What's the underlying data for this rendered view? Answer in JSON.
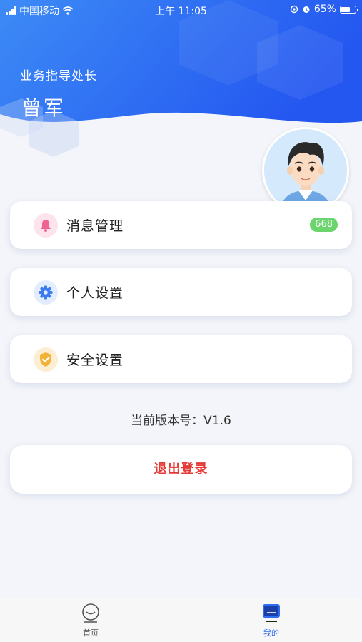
{
  "status_bar": {
    "carrier": "中国移动",
    "time": "上午 11:05",
    "battery": "65%",
    "battery_level": 0.65
  },
  "profile": {
    "role": "业务指导处长",
    "name": "曾军"
  },
  "menu": [
    {
      "label": "消息管理",
      "badge": "668",
      "icon": "bell-icon",
      "color": "#f06292"
    },
    {
      "label": "个人设置",
      "icon": "gear-icon",
      "color": "#3a7bf0"
    },
    {
      "label": "安全设置",
      "icon": "shield-check-icon",
      "color": "#f3b338"
    }
  ],
  "version_text": "当前版本号：V1.6",
  "logout_label": "退出登录",
  "tabbar": {
    "tabs": [
      {
        "label": "首页",
        "icon": "smiley-face-icon",
        "active": false
      },
      {
        "label": "我的",
        "icon": "profile-monitor-icon",
        "active": true
      }
    ]
  },
  "colors": {
    "header_blue": "#2f6cf0",
    "active_tab": "#2f6cf0",
    "badge_green": "#6cd46c",
    "logout_red": "#e53935"
  }
}
